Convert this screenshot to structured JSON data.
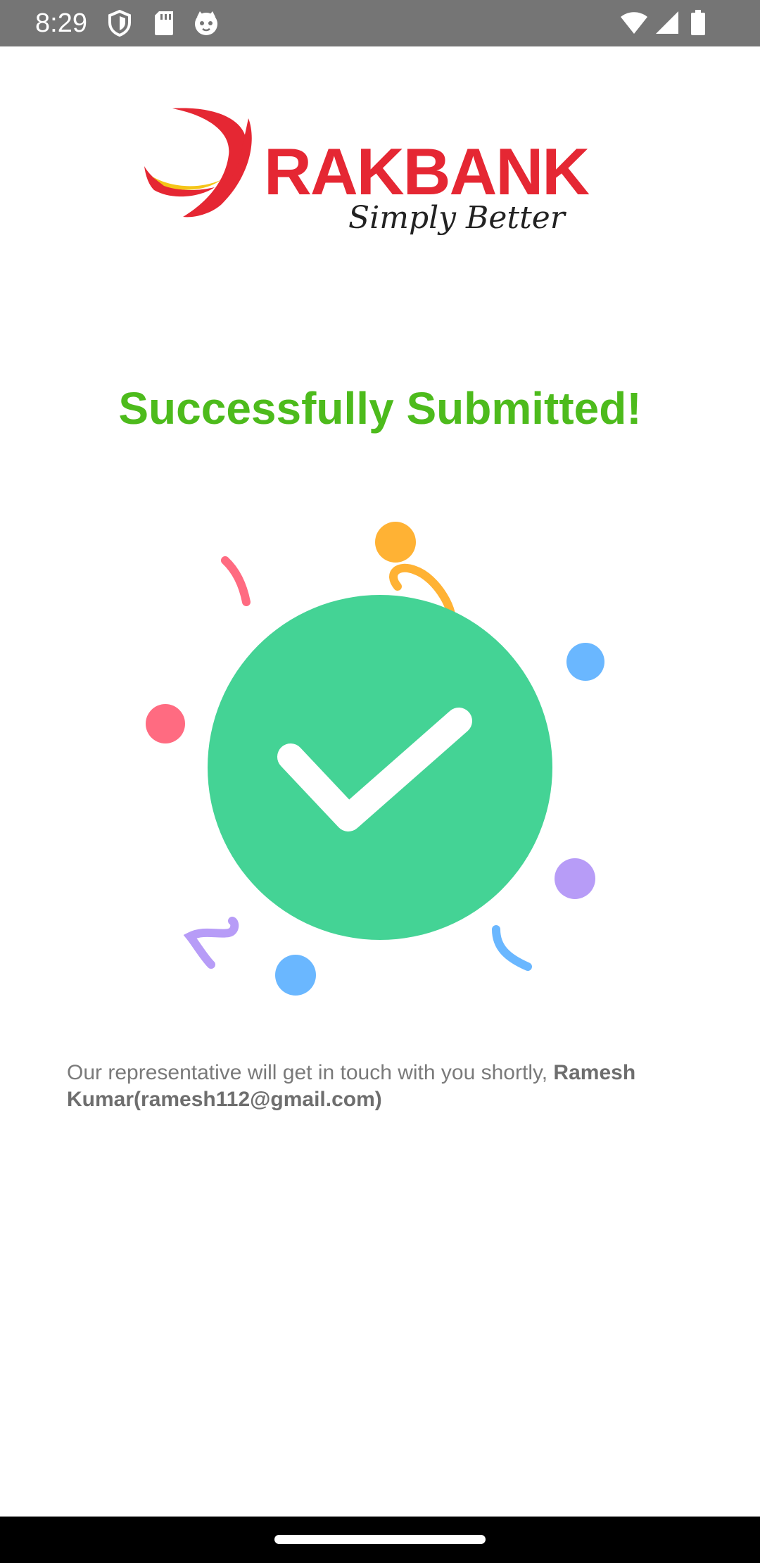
{
  "status_bar": {
    "time": "8:29",
    "icons": [
      "shield-icon",
      "sd-card-icon",
      "cat-face-icon",
      "wifi-icon",
      "signal-icon",
      "battery-icon"
    ]
  },
  "logo": {
    "name": "RAKBANK",
    "tagline": "Simply Better",
    "brand_color": "#e52733",
    "accent_color": "#f5c518"
  },
  "title": "Successfully Submitted!",
  "title_color": "#4dbb1c",
  "illustration": {
    "icon": "checkmark-icon",
    "circle_color": "#44d395",
    "confetti_colors": [
      "#ffb234",
      "#ff6b81",
      "#6ab7ff",
      "#b79cf7"
    ]
  },
  "message": {
    "text": "Our representative will get in touch with you shortly, ",
    "name": "Ramesh Kumar(ramesh112@gmail.com)"
  }
}
